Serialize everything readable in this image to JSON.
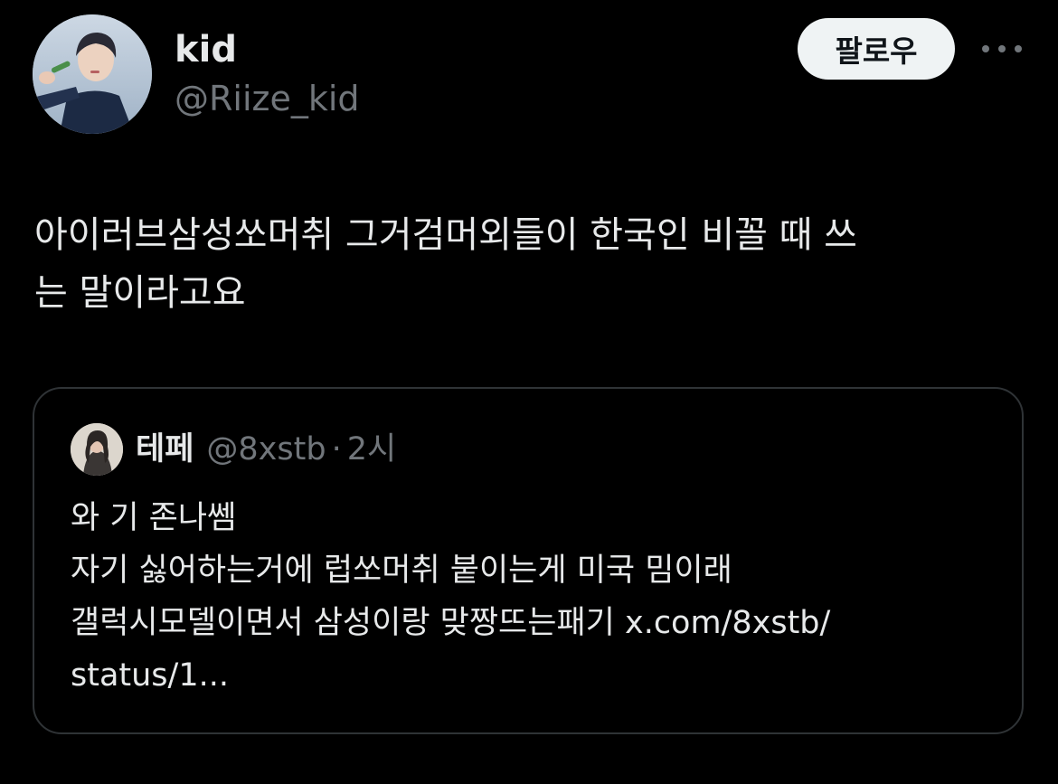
{
  "author": {
    "display_name": "kid",
    "handle": "@Riize_kid",
    "avatar_icon": "profile-photo"
  },
  "follow_button": {
    "label": "팔로우"
  },
  "more_icon": "more-horizontal-icon",
  "tweet": {
    "text": "아이러브삼성쏘머취 그거검머외들이 한국인 비꼴 때 쓰\n는 말이라고요"
  },
  "quote": {
    "display_name": "테페",
    "handle": "@8xstb",
    "separator": "·",
    "time": "2시",
    "lines": [
      "와 기 존나쎔",
      "자기 싫어하는거에 럽쏘머취 붙이는게 미국 밈이래",
      "갤럭시모델이면서 삼성이랑 맞짱뜨는패기 x.com/8xstb/",
      "status/1..."
    ]
  },
  "colors": {
    "background": "#000000",
    "primary_text": "#e7e9ea",
    "secondary_text": "#71767b",
    "border": "#2f3336",
    "button_bg": "#eff3f4"
  }
}
